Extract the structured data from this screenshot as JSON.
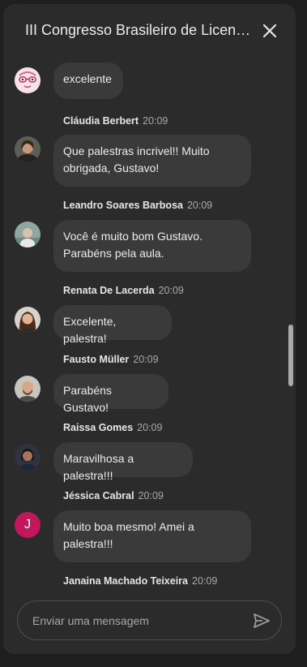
{
  "header": {
    "title": "III Congresso Brasileiro de Licenciaturas em Computação",
    "close_icon": "close-icon"
  },
  "messages": [
    {
      "author": "",
      "time": "",
      "text": "excelente",
      "avatar": "glasses-cartoon-avatar"
    },
    {
      "author": "Cláudia Berbert",
      "time": "20:09",
      "text": "Que palestras incrivel!!  Muito obrigada, Gustavo!",
      "avatar": "photo-avatar"
    },
    {
      "author": "Leandro Soares Barbosa",
      "time": "20:09",
      "text": "Você é muito bom Gustavo. Parabéns pela aula.",
      "avatar": "photo-avatar"
    },
    {
      "author": "Renata De Lacerda",
      "time": "20:09",
      "text": "Excelente, palestra!",
      "avatar": "photo-avatar"
    },
    {
      "author": "Fausto Müller",
      "time": "20:09",
      "text": "Parabéns Gustavo!",
      "avatar": "photo-avatar"
    },
    {
      "author": "Raissa Gomes",
      "time": "20:09",
      "text": "Maravilhosa a palestra!!!",
      "avatar": "photo-avatar"
    },
    {
      "author": "Jéssica Cabral",
      "time": "20:09",
      "text": "Muito boa mesmo! Amei a palestra!!!",
      "avatar": "letter-avatar",
      "avatar_letter": "J",
      "avatar_color": "#c2185b"
    },
    {
      "author": "Janaina Machado Teixeira",
      "time": "20:09",
      "text": "",
      "avatar": ""
    }
  ],
  "composer": {
    "placeholder": "Enviar uma mensagem",
    "value": "",
    "send_icon": "send-icon"
  },
  "colors": {
    "background": "#1f1f1f",
    "panel": "#2b2b2b",
    "bubble": "#3a3a3a",
    "text": "#ececec",
    "meta_text": "#a8a8a8",
    "accent_avatar": "#c2185b"
  }
}
